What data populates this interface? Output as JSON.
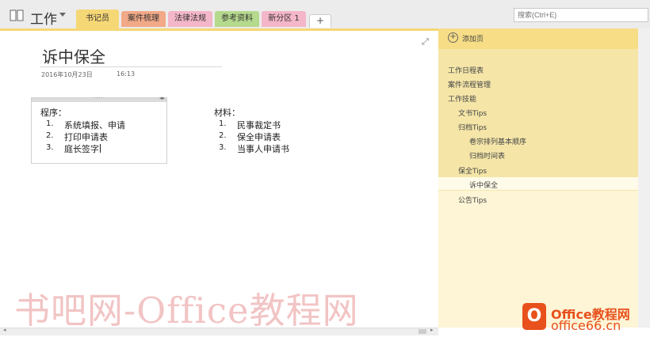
{
  "notebook": {
    "title": "工作"
  },
  "tabs": [
    {
      "label": "书记员",
      "color": "#f5d775",
      "active": true
    },
    {
      "label": "案件梳理",
      "color": "#f2a987"
    },
    {
      "label": "法律法规",
      "color": "#f4b6c9"
    },
    {
      "label": "参考资料",
      "color": "#b5d98d"
    },
    {
      "label": "新分区 1",
      "color": "#f4b6c9"
    }
  ],
  "add_tab_label": "+",
  "search": {
    "placeholder": "搜索(Ctrl+E)"
  },
  "page": {
    "title": "诉中保全",
    "date": "2016年10月23日",
    "time": "16:13",
    "procedure": {
      "label": "程序：",
      "items": [
        {
          "num": "1.",
          "text": "系统填报、申请"
        },
        {
          "num": "2.",
          "text": "打印申请表"
        },
        {
          "num": "3.",
          "text": "庭长签字"
        }
      ]
    },
    "materials": {
      "label": "材料：",
      "items": [
        {
          "num": "1.",
          "text": "民事裁定书"
        },
        {
          "num": "2.",
          "text": "保全申请表"
        },
        {
          "num": "3.",
          "text": "当事人申请书"
        }
      ]
    }
  },
  "sidebar": {
    "add_page": "添加页",
    "pages": [
      {
        "label": "工作日程表",
        "level": 0
      },
      {
        "label": "案件流程管理",
        "level": 0
      },
      {
        "label": "工作技能",
        "level": 0
      },
      {
        "label": "文书Tips",
        "level": 1
      },
      {
        "label": "归档Tips",
        "level": 1
      },
      {
        "label": "卷宗排列基本顺序",
        "level": 2
      },
      {
        "label": "归档时间表",
        "level": 2
      },
      {
        "label": "保全Tips",
        "level": 1
      },
      {
        "label": "诉中保全",
        "level": 2,
        "active": true
      },
      {
        "label": "公告Tips",
        "level": 1
      }
    ]
  },
  "watermark": {
    "text": "书吧网-Office教程网"
  },
  "logo": {
    "line1": "Office教程网",
    "line2": "office66.cn"
  }
}
